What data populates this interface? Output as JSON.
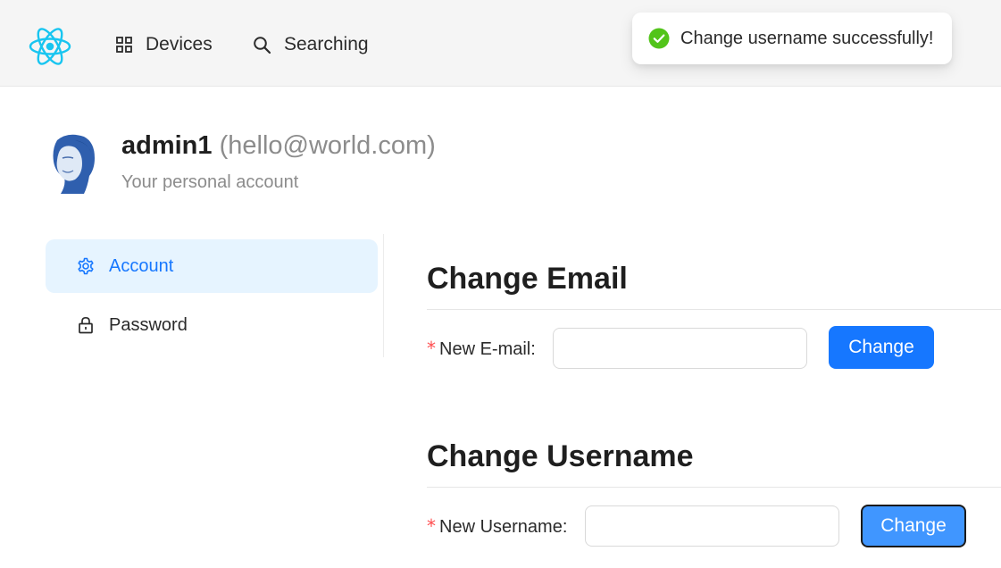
{
  "nav": {
    "logo_icon": "react-atom-icon",
    "devices_label": "Devices",
    "searching_label": "Searching"
  },
  "toast": {
    "message": "Change username successfully!",
    "icon": "check-circle-icon",
    "color": "#52c41a"
  },
  "profile": {
    "username": "admin1",
    "email": "(hello@world.com)",
    "subtitle": "Your personal account"
  },
  "sidemenu": {
    "items": [
      {
        "label": "Account",
        "icon": "gear-icon",
        "active": true
      },
      {
        "label": "Password",
        "icon": "lock-icon",
        "active": false
      }
    ]
  },
  "email_section": {
    "title": "Change Email",
    "field_label": "New E-mail",
    "colon": ":",
    "value": "",
    "button_label": "Change"
  },
  "username_section": {
    "title": "Change Username",
    "field_label": "New Username",
    "colon": ":",
    "value": "",
    "button_label": "Change"
  },
  "required_mark": "*",
  "colors": {
    "accent": "#1677ff",
    "active_bg": "#e6f4ff",
    "required": "#ff4d4f",
    "logo": "#18c5f0"
  }
}
